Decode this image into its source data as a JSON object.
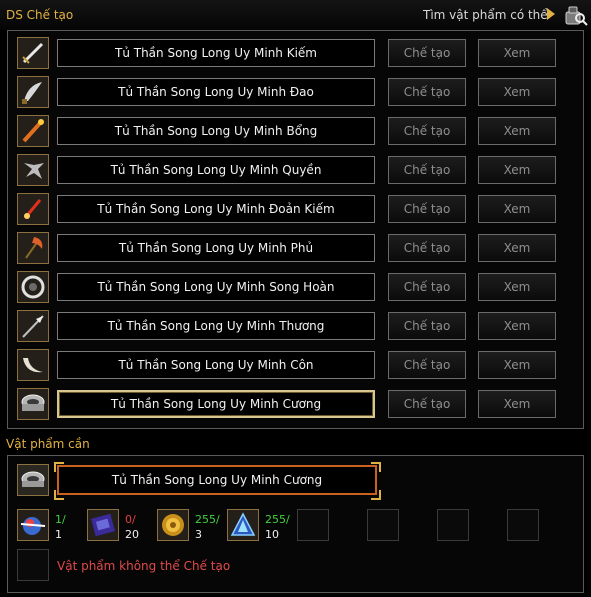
{
  "header": {
    "title": "DS Chế tạo",
    "find_label": "Tìm vật phẩm có thể"
  },
  "items": [
    {
      "name": "Tủ Thần Song Long Uy Minh Kiếm",
      "icon": "sword-icon",
      "craft_label": "Chế tạo",
      "view_label": "Xem"
    },
    {
      "name": "Tủ Thần Song Long Uy Minh Đao",
      "icon": "blade-icon",
      "craft_label": "Chế tạo",
      "view_label": "Xem"
    },
    {
      "name": "Tủ Thần Song Long Uy Minh Bổng",
      "icon": "staff-icon",
      "craft_label": "Chế tạo",
      "view_label": "Xem"
    },
    {
      "name": "Tủ Thần Song Long Uy Minh Quyền",
      "icon": "fist-weapon-icon",
      "craft_label": "Chế tạo",
      "view_label": "Xem"
    },
    {
      "name": "Tủ Thần Song Long Uy Minh Đoản Kiếm",
      "icon": "dagger-icon",
      "craft_label": "Chế tạo",
      "view_label": "Xem"
    },
    {
      "name": "Tủ Thần Song Long Uy Minh Phủ",
      "icon": "axe-icon",
      "craft_label": "Chế tạo",
      "view_label": "Xem"
    },
    {
      "name": "Tủ Thần Song Long Uy Minh Song Hoàn",
      "icon": "ring-blade-icon",
      "craft_label": "Chế tạo",
      "view_label": "Xem"
    },
    {
      "name": "Tủ Thần Song Long Uy Minh Thương",
      "icon": "spear-icon",
      "craft_label": "Chế tạo",
      "view_label": "Xem"
    },
    {
      "name": "Tủ Thần Song Long Uy Minh Côn",
      "icon": "horn-icon",
      "craft_label": "Chế tạo",
      "view_label": "Xem"
    },
    {
      "name": "Tủ Thần Song Long Uy Minh Cương",
      "icon": "bracelet-icon",
      "craft_label": "Chế tạo",
      "view_label": "Xem"
    }
  ],
  "selected_index": 9,
  "required": {
    "title": "Vật phẩm cần",
    "item_name": "Tủ Thần Song Long Uy Minh Cương",
    "materials": [
      {
        "icon": "orb-icon",
        "have": "1/",
        "need": "1",
        "status": "ok"
      },
      {
        "icon": "scroll-icon",
        "have": "0/",
        "need": "20",
        "status": "missing"
      },
      {
        "icon": "coin-icon",
        "have": "255/",
        "need": "3",
        "status": "ok"
      },
      {
        "icon": "crystal-icon",
        "have": "255/",
        "need": "10",
        "status": "ok"
      }
    ],
    "empty_slots": 4,
    "cannot_craft": "Vật phẩm không thể Chế tạo"
  },
  "colors": {
    "accent": "#e2b144",
    "ok": "#3fd13f",
    "missing": "#e04040",
    "selected_border": "#c8621e"
  }
}
